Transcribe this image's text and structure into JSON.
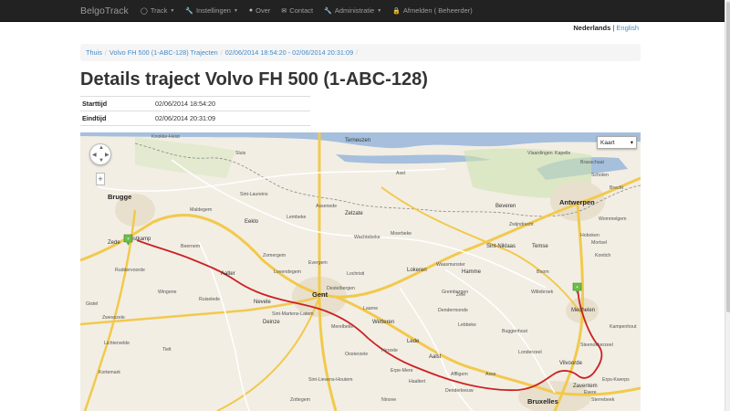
{
  "navbar": {
    "brand": "BelgoTrack",
    "items": [
      {
        "label": "Track",
        "icon": "globe-icon",
        "dropdown": true
      },
      {
        "label": "Instellingen",
        "icon": "wrench-icon",
        "dropdown": true
      },
      {
        "label": "Over",
        "icon": "info-icon",
        "dropdown": false
      },
      {
        "label": "Contact",
        "icon": "envelope-icon",
        "dropdown": false
      },
      {
        "label": "Administratie",
        "icon": "wrench-icon",
        "dropdown": true
      },
      {
        "label": "Afmelden ( Beheerder)",
        "icon": "lock-icon",
        "dropdown": false
      }
    ]
  },
  "language": {
    "active": "Nederlands",
    "separator": "|",
    "other": "English"
  },
  "breadcrumb": {
    "items": [
      "Thuis",
      "Volvo FH 500 (1-ABC-128) Trajecten",
      "02/06/2014 18:54:20 - 02/06/2014 20:31:09"
    ]
  },
  "page": {
    "title": "Details traject Volvo FH 500 (1-ABC-128)"
  },
  "details": [
    {
      "key": "Starttijd",
      "value": "02/06/2014 18:54:20"
    },
    {
      "key": "Eindtijd",
      "value": "02/06/2014 20:31:09"
    }
  ],
  "map": {
    "type_selector": "Kaart",
    "zoom_symbol": "+",
    "route_color": "#cc2222",
    "marker_color": "#6cc04a",
    "labels_big": [
      "Brugge",
      "Gent",
      "Antwerpen",
      "Bruxelles"
    ],
    "labels_mid": [
      "Zede",
      "Oostkamp",
      "Aalter",
      "Nevele",
      "Deinze",
      "Aalst",
      "Mechelen",
      "Vilvoorde",
      "Lokeren",
      "Zelzate",
      "Beveren",
      "Terneuzen",
      "Sint-Niklaas",
      "Lede",
      "Wetteren",
      "Zaventem",
      "Eeklo",
      "Temse",
      "Hamme"
    ],
    "labels_small": [
      "Knokke-Heist",
      "Sluis",
      "Axel",
      "Kapelle",
      "Brasschaat",
      "Maldegem",
      "Lembeke",
      "Sint-Laureins",
      "Assenede",
      "Zwijndrecht",
      "Wommelgem",
      "Kontich",
      "Boom",
      "Willebroek",
      "Lochristi",
      "Evergem",
      "Merelbeke",
      "Laarne",
      "Zele",
      "Dendermonde",
      "Asse",
      "Ninove",
      "Haaltert",
      "Erpe-Mere",
      "Affligem",
      "Beernem",
      "Ruiselede",
      "Tielt",
      "Wingene",
      "Lebbeke",
      "Buggenhout",
      "Londerzeel",
      "Hoboken",
      "Mortsel",
      "Brecht",
      "Wachtebeke",
      "Sint-Martens-Latem",
      "Oosterzele",
      "Sint-Lievens-Houtem",
      "Zottegem",
      "Ruddervoorde",
      "Zomergem",
      "Kortemark",
      "Lichtervelde",
      "Denderleeuw",
      "Evere",
      "Erps-Kwerps",
      "Sterrebeek",
      "Steenokkerzeel",
      "Kampenhout",
      "Gistel",
      "Zwevezele",
      "Herzele",
      "Schoten",
      "Lovendegem",
      "Waasmunster",
      "Moerbeke",
      "Destelbergen",
      "Grembergen",
      "Vlaardingen"
    ]
  }
}
